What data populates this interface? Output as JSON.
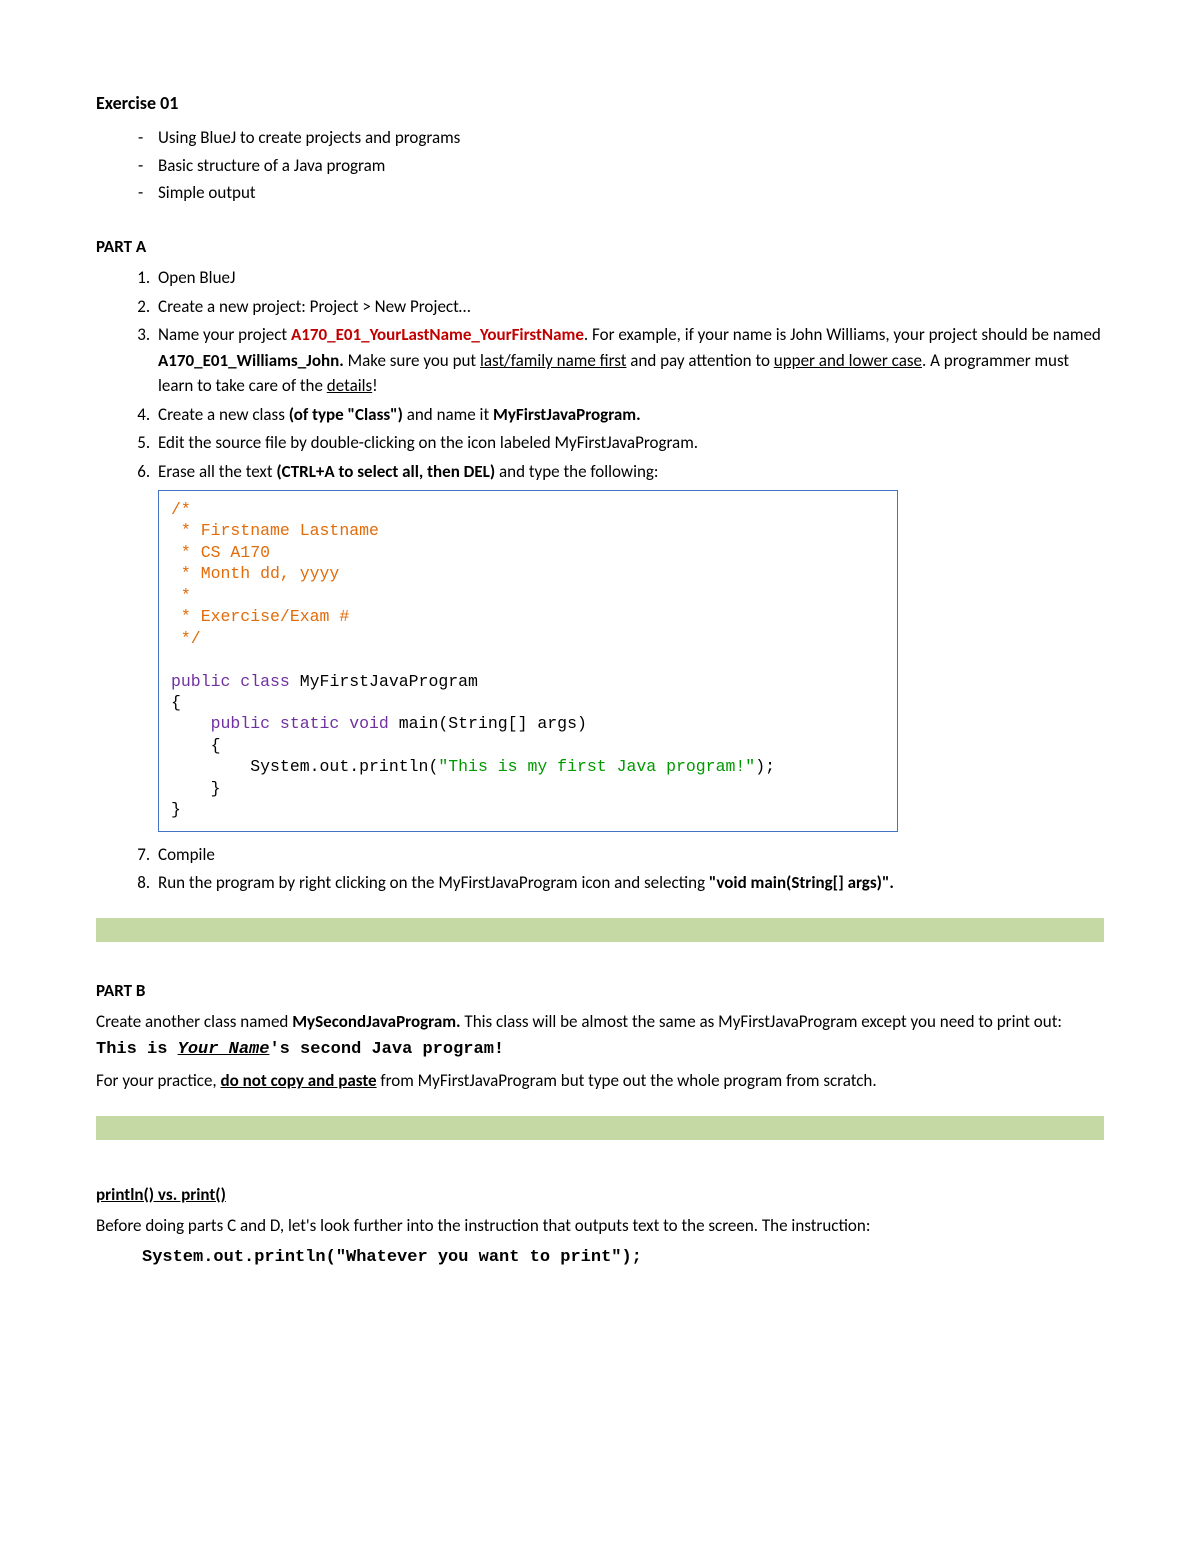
{
  "title": "Exercise 01",
  "intro_items": [
    "Using BlueJ to create projects and programs",
    "Basic structure of a Java program",
    "Simple output"
  ],
  "partA": {
    "label": "PART A",
    "step1": "Open BlueJ",
    "step2": "Create a new project: Project > New Project…",
    "step3_pre": "Name your project ",
    "step3_red": "A170_E01_YourLastName_YourFirstName",
    "step3_mid1": ". For example, if your name is John Williams, your project should be named ",
    "step3_bold": "A170_E01_Williams_John.",
    "step3_mid2": " Make sure you put ",
    "step3_u1": "last/family name first",
    "step3_mid3": " and pay attention to ",
    "step3_u2": "upper and lower case",
    "step3_mid4": ". A programmer must learn to take care of the ",
    "step3_u3": "details",
    "step3_end": "!",
    "step4_pre": "Create a new class ",
    "step4_bold1": "(of type \"Class\")",
    "step4_mid": " and name it ",
    "step4_bold2": "MyFirstJavaProgram.",
    "step5": "Edit the source file by double-clicking on the icon labeled MyFirstJavaProgram.",
    "step6_pre": "Erase all the text ",
    "step6_bold": "(CTRL+A to select all, then DEL)",
    "step6_end": " and type the following:",
    "code": {
      "l1": "/*",
      "l2": " * Firstname Lastname",
      "l3": " * CS A170",
      "l4": " * Month dd, yyyy",
      "l5": " *",
      "l6": " * Exercise/Exam #",
      "l7": " */",
      "l8a": "public class ",
      "l8b": "MyFirstJavaProgram",
      "l9": "{",
      "l10a": "    public static void ",
      "l10b": "main(String[] args)",
      "l11": "    {",
      "l12a": "        System.out.println(",
      "l12b": "\"This is my first Java program!\"",
      "l12c": ");",
      "l13": "    }",
      "l14": "}"
    },
    "step7": "Compile",
    "step8_pre": "Run the program by right clicking on the MyFirstJavaProgram icon and selecting ",
    "step8_bold": "\"void main(String[] args)\".",
    "step8_end": ""
  },
  "partB": {
    "label": "PART B",
    "line1_pre": "Create another class named ",
    "line1_bold": "MySecondJavaProgram.",
    "line1_mid": " This class will be almost the same as MyFirstJavaProgram except you need to print out: ",
    "line1_code1": "This is ",
    "line1_code_ital": "Your Name",
    "line1_code2": "'s second Java program!",
    "line2_pre": "For your practice, ",
    "line2_u": "do not copy and paste",
    "line2_end": " from MyFirstJavaProgram but type out the whole program from scratch."
  },
  "println_section": {
    "heading": "println() vs. print()",
    "para": "Before doing parts C and D, let's look further into the instruction that outputs text to the screen. The instruction:",
    "code": "System.out.println(\"Whatever you want to print\");"
  }
}
